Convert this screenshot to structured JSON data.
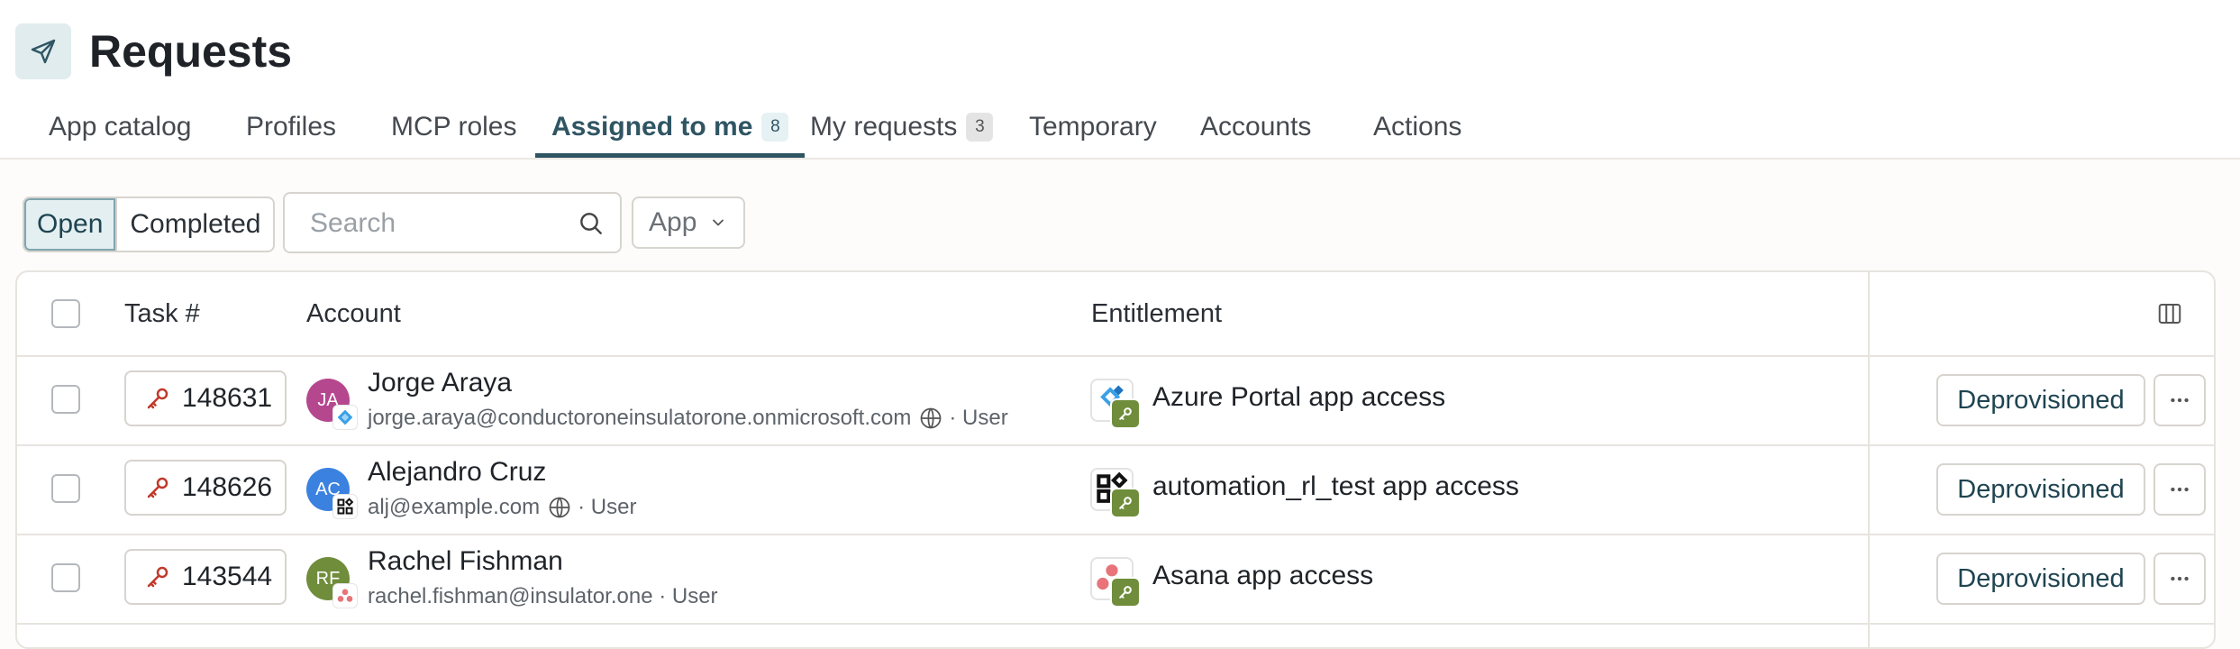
{
  "page": {
    "title": "Requests",
    "icon": "paper-plane-icon"
  },
  "tabs": [
    {
      "label": "App catalog"
    },
    {
      "label": "Profiles"
    },
    {
      "label": "MCP roles"
    },
    {
      "label": "Assigned to me",
      "badge": "8",
      "active": true
    },
    {
      "label": "My requests",
      "badge": "3"
    },
    {
      "label": "Temporary"
    },
    {
      "label": "Accounts"
    },
    {
      "label": "Actions"
    }
  ],
  "filters": {
    "status_options": [
      "Open",
      "Completed"
    ],
    "selected_status": "Open",
    "search_placeholder": "Search",
    "app_dropdown_label": "App"
  },
  "table": {
    "columns": [
      "Task #",
      "Account",
      "Entitlement"
    ],
    "rows": [
      {
        "task": "148631",
        "account_name": "Jorge Araya",
        "account_initials": "JA",
        "account_email": "jorge.araya@conductoroneinsulatorone.onmicrosoft.com",
        "account_type": "· User",
        "entitlement": "Azure Portal app access",
        "app_icon": "azure-icon",
        "status": "Deprovisioned"
      },
      {
        "task": "148626",
        "account_name": "Alejandro Cruz",
        "account_initials": "AC",
        "account_email": "alj@example.com",
        "account_type": "· User",
        "entitlement": "automation_rl_test app access",
        "app_icon": "app-grid-icon",
        "status": "Deprovisioned"
      },
      {
        "task": "143544",
        "account_name": "Rachel Fishman",
        "account_initials": "RF",
        "account_email": "rachel.fishman@insulator.one",
        "account_type": "· User",
        "entitlement": "Asana app access",
        "app_icon": "asana-icon",
        "status": "Deprovisioned"
      }
    ]
  },
  "colors": {
    "accent": "#2f5563",
    "key_red": "#c0392b",
    "badge_green": "#6f8d3b"
  }
}
